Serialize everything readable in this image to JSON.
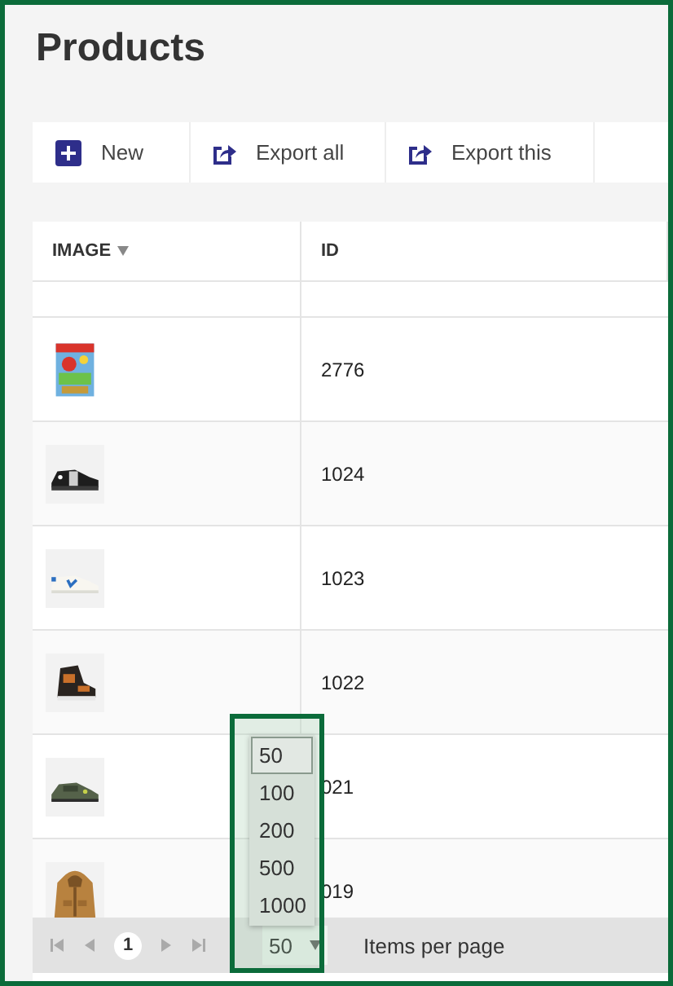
{
  "title": "Products",
  "toolbar": [
    {
      "kind": "new",
      "label": "New"
    },
    {
      "kind": "export",
      "label": "Export all"
    },
    {
      "kind": "export",
      "label": "Export this"
    }
  ],
  "table": {
    "columns": [
      {
        "label": "IMAGE",
        "sorted": true
      },
      {
        "label": "ID",
        "sorted": false
      }
    ],
    "rows": [
      {
        "id": "2776"
      },
      {
        "id": "1024"
      },
      {
        "id": "1023"
      },
      {
        "id": "1022"
      },
      {
        "id": "021"
      },
      {
        "id": "019"
      }
    ]
  },
  "pager": {
    "pages": [
      {
        "label": "1",
        "selected": true
      }
    ],
    "per_page": {
      "value": "50",
      "expanded": true,
      "options": [
        {
          "label": "50",
          "selected": true
        },
        {
          "label": "100",
          "selected": false
        },
        {
          "label": "200",
          "selected": false
        },
        {
          "label": "500",
          "selected": false
        },
        {
          "label": "1000",
          "selected": false
        }
      ]
    },
    "per_page_label": "Items per page"
  }
}
